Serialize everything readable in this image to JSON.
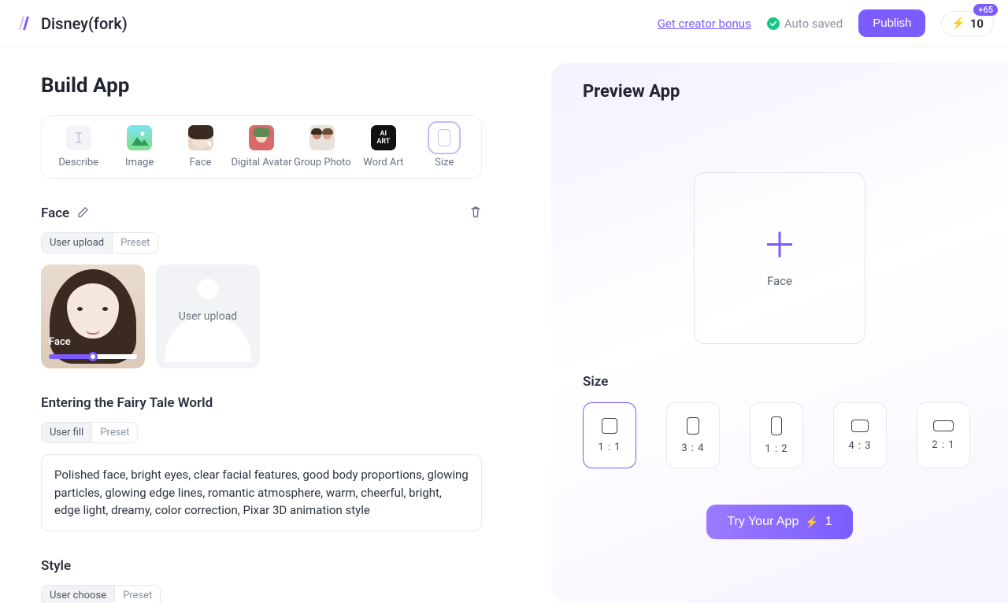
{
  "header": {
    "app_title": "Disney(fork)",
    "creator_link": "Get creator bonus",
    "auto_saved": "Auto saved",
    "publish": "Publish",
    "credits": "10",
    "credit_badge": "+65"
  },
  "build": {
    "title": "Build App",
    "types": [
      {
        "label": "Describe"
      },
      {
        "label": "Image"
      },
      {
        "label": "Face"
      },
      {
        "label": "Digital Avatar"
      },
      {
        "label": "Group Photo"
      },
      {
        "label": "Word Art"
      },
      {
        "label": "Size",
        "selected": true
      }
    ],
    "face_section": {
      "label": "Face",
      "pills": {
        "a": "User upload",
        "b": "Preset"
      },
      "example_caption": "Face",
      "upload_text": "User upload"
    },
    "prompt_section": {
      "label": "Entering the Fairy Tale World",
      "pills": {
        "a": "User fill",
        "b": "Preset"
      },
      "text": "Polished face, bright eyes, clear facial features, good body proportions, glowing particles, glowing edge lines, romantic atmosphere, warm, cheerful, bright, edge light, dreamy, color correction, Pixar 3D animation style"
    },
    "style_section": {
      "label": "Style",
      "pills": {
        "a": "User choose",
        "b": "Preset"
      }
    }
  },
  "preview": {
    "title": "Preview App",
    "drop_label": "Face",
    "size_title": "Size",
    "sizes": [
      {
        "label": "1 : 1",
        "cls": "sz-11",
        "active": true
      },
      {
        "label": "3 : 4",
        "cls": "sz-34"
      },
      {
        "label": "1 : 2",
        "cls": "sz-12"
      },
      {
        "label": "4 : 3",
        "cls": "sz-43"
      },
      {
        "label": "2 : 1",
        "cls": "sz-21"
      }
    ],
    "try_button": "Try Your App",
    "try_cost": "1"
  }
}
